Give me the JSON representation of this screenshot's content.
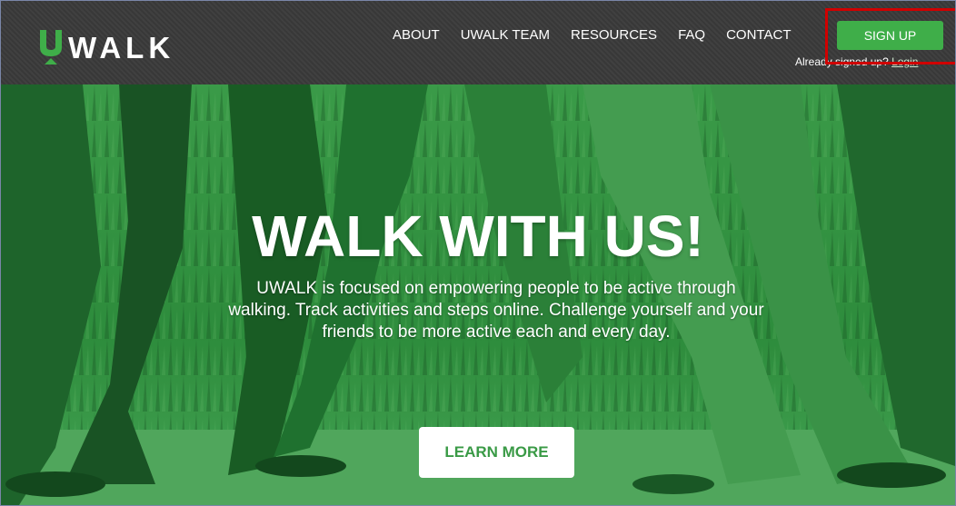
{
  "brand": {
    "logo_text": "WALK",
    "logo_letter": "U",
    "accent": "#3fae49",
    "header_bg": "#3a3a3a",
    "hero_tint": "#2f8a3c"
  },
  "nav": {
    "items": [
      {
        "label": "ABOUT"
      },
      {
        "label": "UWALK TEAM"
      },
      {
        "label": "RESOURCES"
      },
      {
        "label": "FAQ"
      },
      {
        "label": "CONTACT"
      }
    ],
    "signup_label": "SIGN UP",
    "already_text": "Already signed up? ",
    "login_text": "Login"
  },
  "hero": {
    "title": "WALK WITH US!",
    "description": "UWALK is focused on empowering people to be active through walking. Track activities and steps online. Challenge yourself and your friends to be more active each and every day.",
    "cta_label": "LEARN MORE"
  },
  "annotation": {
    "highlight_color": "#d00000",
    "highlight_target": "signup-button"
  }
}
